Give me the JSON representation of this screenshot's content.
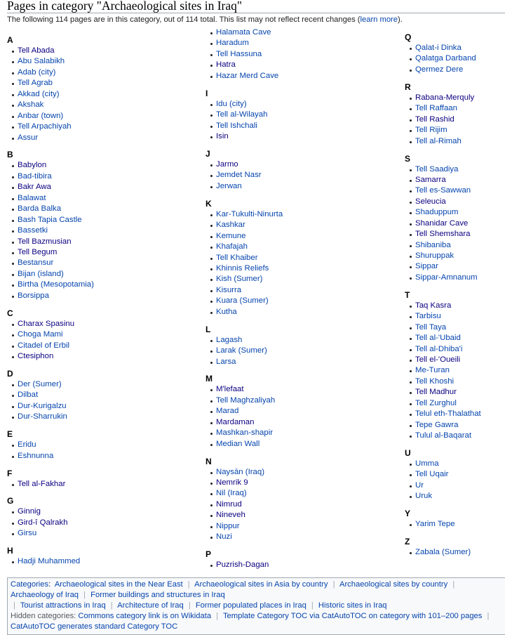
{
  "title": "Pages in category \"Archaeological sites in Iraq\"",
  "description": {
    "text": "The following 114 pages are in this category, out of 114 total. This list may not reflect recent changes (",
    "link": "learn more",
    "after": ")."
  },
  "colors": {
    "link": "#0645ad",
    "visited_link": "#0b0080",
    "text": "#202122",
    "border": "#a2a9b1"
  },
  "columns": [
    [
      {
        "letter": "A",
        "items": [
          {
            "t": "Tell Abada",
            "v": true
          },
          {
            "t": "Abu Salabikh"
          },
          {
            "t": "Adab (city)"
          },
          {
            "t": "Tell Agrab"
          },
          {
            "t": "Akkad (city)"
          },
          {
            "t": "Akshak"
          },
          {
            "t": "Anbar (town)"
          },
          {
            "t": "Tell Arpachiyah"
          },
          {
            "t": "Assur"
          }
        ]
      },
      {
        "letter": "B",
        "items": [
          {
            "t": "Babylon",
            "v": true
          },
          {
            "t": "Bad-tibira"
          },
          {
            "t": "Bakr Awa",
            "v": true
          },
          {
            "t": "Balawat"
          },
          {
            "t": "Barda Balka"
          },
          {
            "t": "Bash Tapia Castle"
          },
          {
            "t": "Bassetki"
          },
          {
            "t": "Tell Bazmusian",
            "v": true
          },
          {
            "t": "Tell Begum",
            "v": true
          },
          {
            "t": "Bestansur"
          },
          {
            "t": "Bijan (island)"
          },
          {
            "t": "Birtha (Mesopotamia)"
          },
          {
            "t": "Borsippa"
          }
        ]
      },
      {
        "letter": "C",
        "items": [
          {
            "t": "Charax Spasinu",
            "v": true
          },
          {
            "t": "Choga Mami"
          },
          {
            "t": "Citadel of Erbil"
          },
          {
            "t": "Ctesiphon",
            "v": true
          }
        ]
      },
      {
        "letter": "D",
        "items": [
          {
            "t": "Der (Sumer)"
          },
          {
            "t": "Dilbat"
          },
          {
            "t": "Dur-Kurigalzu"
          },
          {
            "t": "Dur-Sharrukin"
          }
        ]
      },
      {
        "letter": "E",
        "items": [
          {
            "t": "Eridu"
          },
          {
            "t": "Eshnunna"
          }
        ]
      },
      {
        "letter": "F",
        "items": [
          {
            "t": "Tell al-Fakhar",
            "v": true
          }
        ]
      },
      {
        "letter": "G",
        "items": [
          {
            "t": "Ginnig",
            "v": true
          },
          {
            "t": "Gird-î Qalrakh",
            "v": true
          },
          {
            "t": "Girsu"
          }
        ]
      },
      {
        "letter": "H",
        "items": [
          {
            "t": "Hadji Muhammed"
          }
        ]
      }
    ],
    [
      {
        "letter": "",
        "items": [
          {
            "t": "Halamata Cave"
          },
          {
            "t": "Haradum"
          },
          {
            "t": "Tell Hassuna"
          },
          {
            "t": "Hatra",
            "v": true
          },
          {
            "t": "Hazar Merd Cave"
          }
        ]
      },
      {
        "letter": "I",
        "items": [
          {
            "t": "Idu (city)"
          },
          {
            "t": "Tell al-Wilayah"
          },
          {
            "t": "Tell Ishchali"
          },
          {
            "t": "Isin",
            "v": true
          }
        ]
      },
      {
        "letter": "J",
        "items": [
          {
            "t": "Jarmo",
            "v": true
          },
          {
            "t": "Jemdet Nasr"
          },
          {
            "t": "Jerwan"
          }
        ]
      },
      {
        "letter": "K",
        "items": [
          {
            "t": "Kar-Tukulti-Ninurta"
          },
          {
            "t": "Kashkar"
          },
          {
            "t": "Kemune"
          },
          {
            "t": "Khafajah"
          },
          {
            "t": "Tell Khaiber"
          },
          {
            "t": "Khinnis Reliefs"
          },
          {
            "t": "Kish (Sumer)"
          },
          {
            "t": "Kisurra"
          },
          {
            "t": "Kuara (Sumer)"
          },
          {
            "t": "Kutha"
          }
        ]
      },
      {
        "letter": "L",
        "items": [
          {
            "t": "Lagash"
          },
          {
            "t": "Larak (Sumer)"
          },
          {
            "t": "Larsa"
          }
        ]
      },
      {
        "letter": "M",
        "items": [
          {
            "t": "M'lefaat",
            "v": true
          },
          {
            "t": "Tell Maghzaliyah"
          },
          {
            "t": "Marad"
          },
          {
            "t": "Mardaman",
            "v": true
          },
          {
            "t": "Mashkan-shapir"
          },
          {
            "t": "Median Wall"
          }
        ]
      },
      {
        "letter": "N",
        "items": [
          {
            "t": "Naysān (Iraq)"
          },
          {
            "t": "Nemrik 9",
            "v": true
          },
          {
            "t": "Nil (Iraq)"
          },
          {
            "t": "Nimrud",
            "v": true
          },
          {
            "t": "Nineveh",
            "v": true
          },
          {
            "t": "Nippur"
          },
          {
            "t": "Nuzi"
          }
        ]
      },
      {
        "letter": "P",
        "items": [
          {
            "t": "Puzrish-Dagan",
            "v": true
          }
        ]
      }
    ],
    [
      {
        "letter": "Q",
        "items": [
          {
            "t": "Qalat-i Dinka"
          },
          {
            "t": "Qalatga Darband"
          },
          {
            "t": "Qermez Dere"
          }
        ]
      },
      {
        "letter": "R",
        "items": [
          {
            "t": "Rabana-Merquly",
            "v": true
          },
          {
            "t": "Tell Raffaan"
          },
          {
            "t": "Tell Rashid",
            "v": true
          },
          {
            "t": "Tell Rijim"
          },
          {
            "t": "Tell al-Rimah"
          }
        ]
      },
      {
        "letter": "S",
        "items": [
          {
            "t": "Tell Saadiya"
          },
          {
            "t": "Samarra",
            "v": true
          },
          {
            "t": "Tell es-Sawwan"
          },
          {
            "t": "Seleucia",
            "v": true
          },
          {
            "t": "Shaduppum"
          },
          {
            "t": "Shanidar Cave",
            "v": true
          },
          {
            "t": "Tell Shemshara",
            "v": true
          },
          {
            "t": "Shibaniba"
          },
          {
            "t": "Shuruppak"
          },
          {
            "t": "Sippar"
          },
          {
            "t": "Sippar-Amnanum"
          }
        ]
      },
      {
        "letter": "T",
        "items": [
          {
            "t": "Taq Kasra",
            "v": true
          },
          {
            "t": "Tarbisu"
          },
          {
            "t": "Tell Taya"
          },
          {
            "t": "Tell al-'Ubaid"
          },
          {
            "t": "Tell al-Dhiba'i"
          },
          {
            "t": "Tell el-'Oueili",
            "v": true
          },
          {
            "t": "Me-Turan"
          },
          {
            "t": "Tell Khoshi"
          },
          {
            "t": "Tell Madhur",
            "v": true
          },
          {
            "t": "Tell Zurghul"
          },
          {
            "t": "Telul eth-Thalathat"
          },
          {
            "t": "Tepe Gawra"
          },
          {
            "t": "Tulul al-Baqarat"
          }
        ]
      },
      {
        "letter": "U",
        "items": [
          {
            "t": "Umma"
          },
          {
            "t": "Tell Uqair"
          },
          {
            "t": "Ur"
          },
          {
            "t": "Uruk"
          }
        ]
      },
      {
        "letter": "Y",
        "items": [
          {
            "t": "Yarim Tepe"
          }
        ]
      },
      {
        "letter": "Z",
        "items": [
          {
            "t": "Zabala (Sumer)"
          }
        ]
      }
    ]
  ],
  "categories": {
    "label": "Categories",
    "line1": [
      "Archaeological sites in the Near East",
      "Archaeological sites in Asia by country",
      "Archaeological sites by country",
      "Archaeology of Iraq",
      "Former buildings and structures in Iraq"
    ],
    "line2": [
      "Tourist attractions in Iraq",
      "Architecture of Iraq",
      "Former populated places in Iraq",
      "Historic sites in Iraq"
    ],
    "hidden_label": "Hidden categories",
    "hidden": [
      "Commons category link is on Wikidata",
      "Template Category TOC via CatAutoTOC on category with 101–200 pages",
      "CatAutoTOC generates standard Category TOC"
    ]
  }
}
